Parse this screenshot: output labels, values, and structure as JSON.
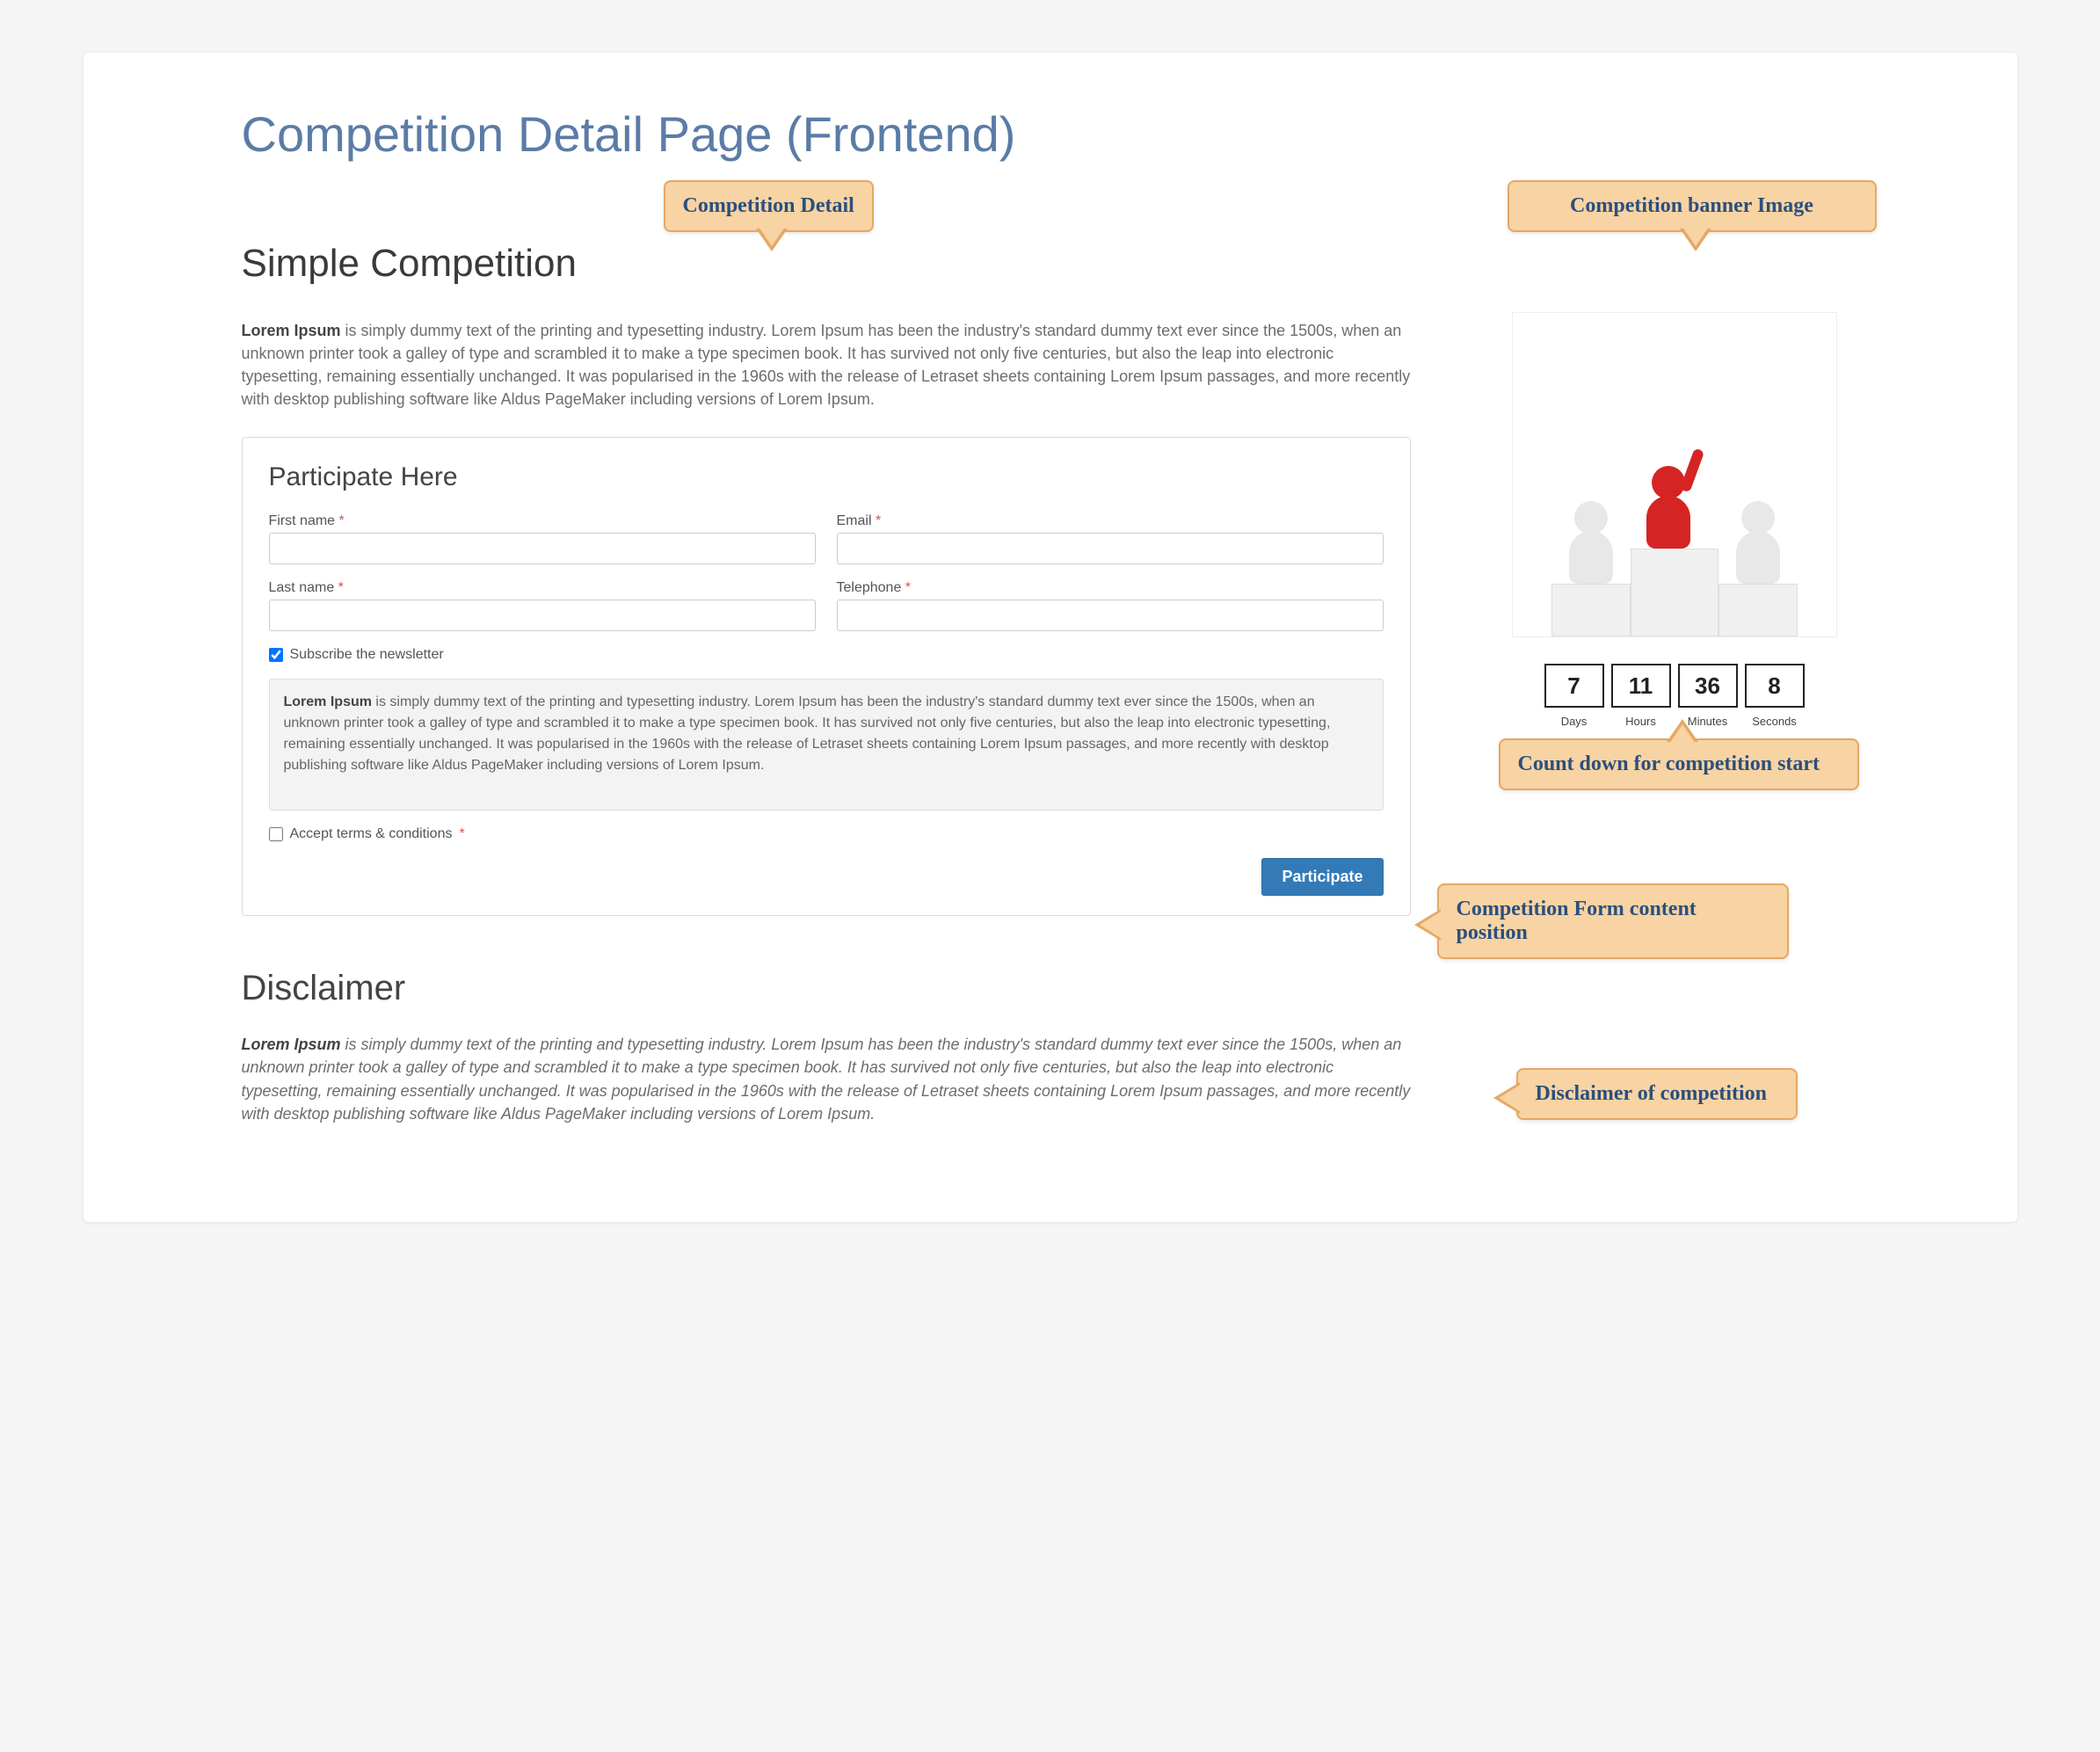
{
  "page_title": "Competition Detail Page (Frontend)",
  "competition": {
    "title": "Simple Competition",
    "description_lead": "Lorem Ipsum",
    "description_rest": " is simply dummy text of the printing and typesetting industry. Lorem Ipsum has been the industry's standard dummy text ever since the 1500s, when an unknown printer took a galley of type and scrambled it to make a type specimen book. It has survived not only five centuries, but also the leap into electronic typesetting, remaining essentially unchanged. It was popularised in the 1960s with the release of Letraset sheets containing Lorem Ipsum passages, and more recently with desktop publishing software like Aldus PageMaker including versions of Lorem Ipsum."
  },
  "form": {
    "heading": "Participate Here",
    "first_name_label": "First name",
    "email_label": "Email",
    "last_name_label": "Last name",
    "telephone_label": "Telephone",
    "subscribe_label": "Subscribe the newsletter",
    "subscribe_checked": true,
    "terms_text_lead": "Lorem Ipsum",
    "terms_text_rest": " is simply dummy text of the printing and typesetting industry. Lorem Ipsum has been the industry's standard dummy text ever since the 1500s, when an unknown printer took a galley of type and scrambled it to make a type specimen book. It has survived not only five centuries, but also the leap into electronic typesetting, remaining essentially unchanged. It was popularised in the 1960s with the release of Letraset sheets containing Lorem Ipsum passages, and more recently with desktop publishing software like Aldus PageMaker including versions of Lorem Ipsum.",
    "accept_label": "Accept terms & conditions",
    "accept_checked": false,
    "submit_label": "Participate"
  },
  "disclaimer": {
    "heading": "Disclaimer",
    "text_lead": "Lorem Ipsum",
    "text_rest": " is simply dummy text of the printing and typesetting industry. Lorem Ipsum has been the industry's standard dummy text ever since the 1500s, when an unknown printer took a galley of type and scrambled it to make a type specimen book. It has survived not only five centuries, but also the leap into electronic typesetting, remaining essentially unchanged. It was popularised in the 1960s with the release of Letraset sheets containing Lorem Ipsum passages, and more recently with desktop publishing software like Aldus PageMaker including versions of Lorem Ipsum."
  },
  "countdown": {
    "days": "7",
    "hours": "11",
    "minutes": "36",
    "seconds": "8",
    "days_label": "Days",
    "hours_label": "Hours",
    "minutes_label": "Minutes",
    "seconds_label": "Seconds"
  },
  "callouts": {
    "detail": "Competition Detail",
    "banner": "Competition banner Image",
    "countdown": "Count down for competition start",
    "form": "Competition Form content position",
    "disclaimer": "Disclaimer of competition"
  },
  "required_marker": "*"
}
